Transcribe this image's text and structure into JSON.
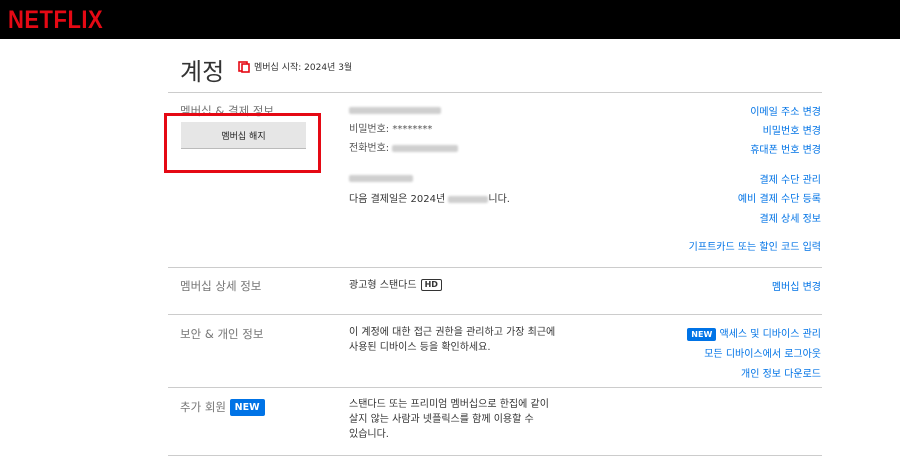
{
  "header": {
    "logo": "NETFLIX"
  },
  "account": {
    "title": "계정",
    "member_since": "멤버십 시작: 2024년 3월"
  },
  "membership_billing": {
    "label": "멤버십 & 결제 정보",
    "cancel_button": "멤버십 해지",
    "password": "비밀번호: ********",
    "phone_label": "전화번호:",
    "next_billing_prefix": "다음 결제일은 2024년",
    "next_billing_suffix": "니다.",
    "links": {
      "change_email": "이메일 주소 변경",
      "change_password": "비밀번호 변경",
      "change_phone": "휴대폰 번호 변경",
      "manage_payment": "결제 수단 관리",
      "add_backup_payment": "예비 결제 수단 등록",
      "billing_details": "결제 상세 정보",
      "redeem_gift": "기프트카드 또는 할인 코드 입력"
    }
  },
  "plan": {
    "label": "멤버십 상세 정보",
    "plan_name": "광고형 스탠다드",
    "hd": "HD",
    "change_plan": "멤버십 변경"
  },
  "security": {
    "label": "보안 & 개인 정보",
    "description_line1": "이 계정에 대한 접근 권한을 관리하고 가장 최근에",
    "description_line2": "사용된 디바이스 등을 확인하세요.",
    "new_badge": "NEW",
    "manage_access": "액세스 및 디바이스 관리",
    "sign_out_all": "모든 디바이스에서 로그아웃",
    "download_info": "개인 정보 다운로드"
  },
  "extra_member": {
    "label": "추가 회원",
    "new_badge": "NEW",
    "description_line1": "스탠다드 또는 프리미엄 멤버십으로 한집에 같이",
    "description_line2": "살지 않는 사람과 넷플릭스를 함께 이용할 수",
    "description_line3": "있습니다."
  },
  "colors": {
    "brand": "#e50914",
    "link": "#0073e6",
    "badge": "#0073e6"
  }
}
